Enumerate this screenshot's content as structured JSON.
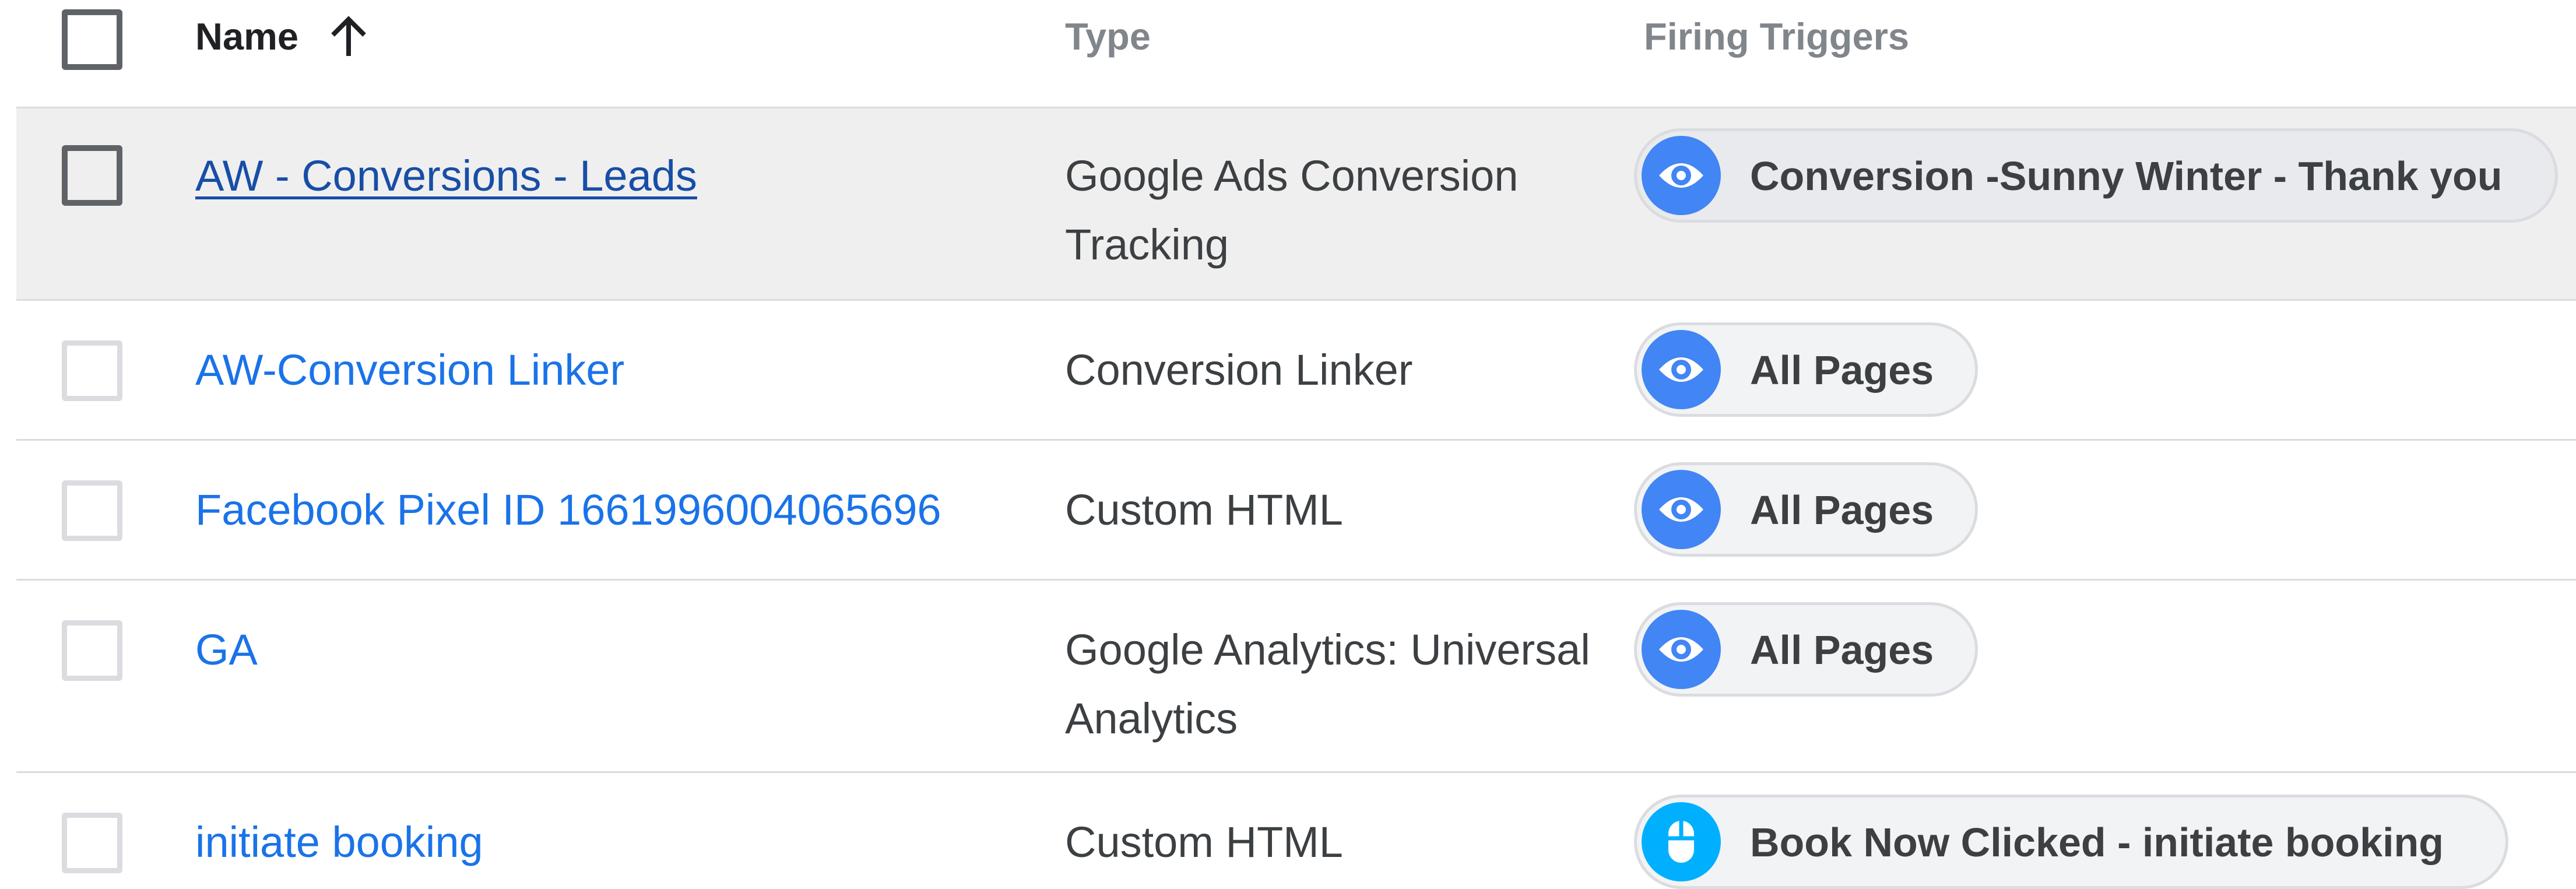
{
  "header": {
    "name_label": "Name",
    "type_label": "Type",
    "triggers_label": "Firing Triggers"
  },
  "rows": [
    {
      "name": "AW - Conversions - Leads",
      "type": "Google Ads Conversion\nTracking",
      "trigger": {
        "label": "Conversion -Sunny Winter - Thank you",
        "icon": "eye-icon"
      }
    },
    {
      "name": "AW-Conversion Linker",
      "type": "Conversion Linker",
      "trigger": {
        "label": "All Pages",
        "icon": "eye-icon"
      }
    },
    {
      "name": "Facebook Pixel ID 1661996004065696",
      "type": "Custom HTML",
      "trigger": {
        "label": "All Pages",
        "icon": "eye-icon"
      }
    },
    {
      "name": "GA",
      "type": "Google Analytics: Universal\nAnalytics",
      "trigger": {
        "label": "All Pages",
        "icon": "eye-icon"
      }
    },
    {
      "name": "initiate booking",
      "type": "Custom HTML",
      "trigger": {
        "label": "Book Now Clicked - initiate booking",
        "icon": "mouse-icon"
      }
    }
  ],
  "colors": {
    "link": "#1a73e8",
    "visited_link": "#174ea6",
    "pageview_trigger": "#4285f4",
    "click_trigger": "#00b0ff",
    "row_highlight": "#efefef",
    "divider": "#dadce0"
  }
}
